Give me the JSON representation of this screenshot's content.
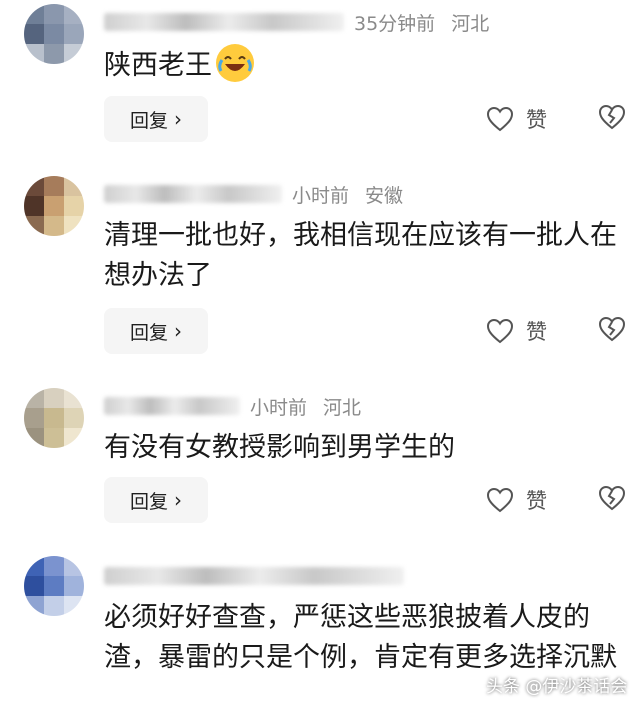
{
  "comments": [
    {
      "time": "35分钟前",
      "location": "河北",
      "text": "陕西老王",
      "reply_label": "回复",
      "like_label": "赞",
      "emoji": "laughing-tears"
    },
    {
      "time": "小时前",
      "location": "安徽",
      "text": "清理一批也好，我相信现在应该有一批人在想办法了",
      "reply_label": "回复",
      "like_label": "赞"
    },
    {
      "time": "小时前",
      "location": "河北",
      "text": "有没有女教授影响到男学生的",
      "reply_label": "回复",
      "like_label": "赞"
    },
    {
      "time": "",
      "location": "",
      "text": "必须好好查查，严惩这些恶狼披着人皮的渣，暴雷的只是个例，肯定有更多选择沉默",
      "reply_label": "",
      "like_label": ""
    }
  ],
  "watermark": "头条 @伊沙茶话会",
  "colors": {
    "meta": "#8a8a8a",
    "reply_bg": "#f5f5f5",
    "text": "#1a1a1a"
  }
}
